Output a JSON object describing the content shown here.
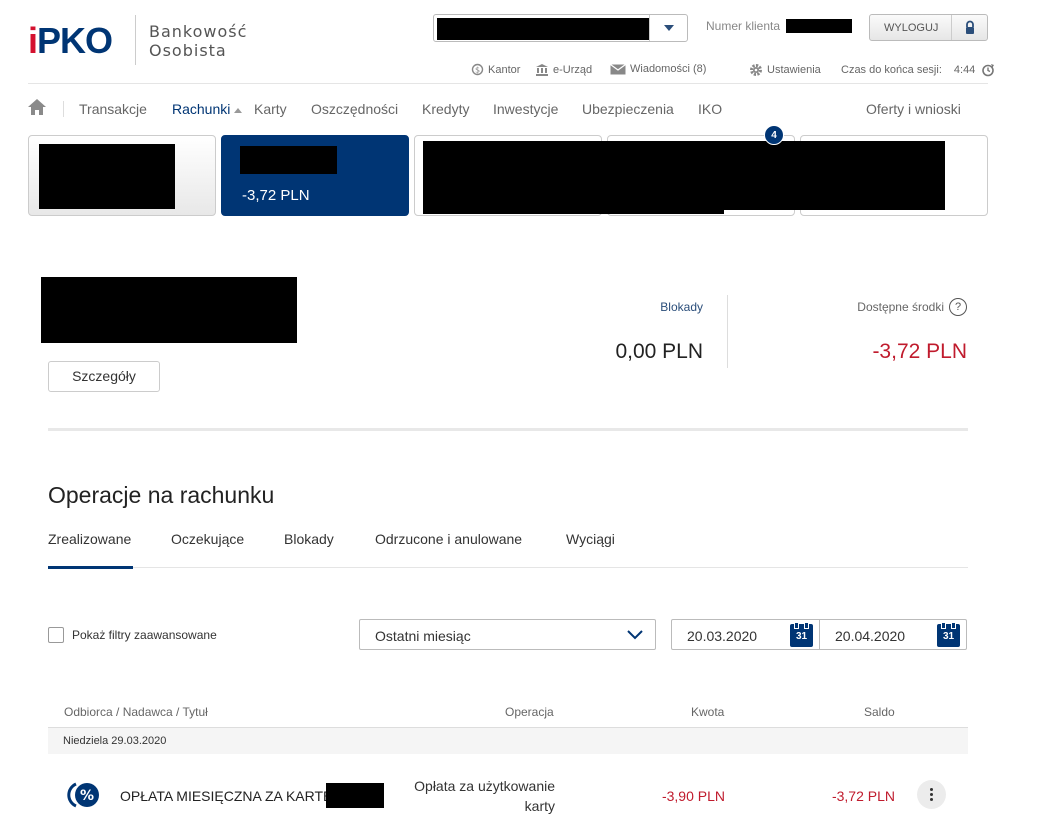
{
  "header": {
    "logo_i": "i",
    "logo_pko": "PKO",
    "brand_line1": "Bankowość",
    "brand_line2": "Osobista",
    "client_label": "Numer klienta",
    "logout_label": "WYLOGUJ"
  },
  "utility": {
    "kantor": "Kantor",
    "eurzad": "e-Urząd",
    "messages": "Wiadomości (8)",
    "settings": "Ustawienia",
    "session_label": "Czas do końca sesji:",
    "session_time": "4:44"
  },
  "nav": {
    "transakcje": "Transakcje",
    "rachunki": "Rachunki",
    "karty": "Karty",
    "oszczednosci": "Oszczędności",
    "kredyty": "Kredyty",
    "inwestycje": "Inwestycje",
    "ubezpieczenia": "Ubezpieczenia",
    "iko": "IKO",
    "oferty": "Oferty i wnioski"
  },
  "tiles": {
    "active_balance": "-3,72 PLN",
    "badge_count": "4"
  },
  "summary": {
    "details_button": "Szczegóły",
    "blocks_label": "Blokady",
    "blocks_value": "0,00 PLN",
    "available_label": "Dostępne środki",
    "available_value": "-3,72 PLN",
    "help_symbol": "?"
  },
  "operations": {
    "title": "Operacje na rachunku",
    "tabs": [
      "Zrealizowane",
      "Oczekujące",
      "Blokady",
      "Odrzucone i anulowane",
      "Wyciągi"
    ],
    "advanced_filters_label": "Pokaż filtry zaawansowane",
    "period_value": "Ostatni miesiąc",
    "date_from": "20.03.2020",
    "date_to": "20.04.2020",
    "calendar_day": "31",
    "columns": {
      "party": "Odbiorca / Nadawca / Tytuł",
      "operation": "Operacja",
      "amount": "Kwota",
      "balance": "Saldo"
    },
    "date_group": "Niedziela 29.03.2020",
    "rows": [
      {
        "title": "OPŁATA MIESIĘCZNA ZA KARTĘ",
        "type_line1": "Opłata za użytkowanie",
        "type_line2": "karty",
        "amount": "-3,90 PLN",
        "balance": "-3,72 PLN"
      }
    ]
  },
  "colors": {
    "brand_navy": "#003574",
    "negative_red": "#c01b2d"
  }
}
